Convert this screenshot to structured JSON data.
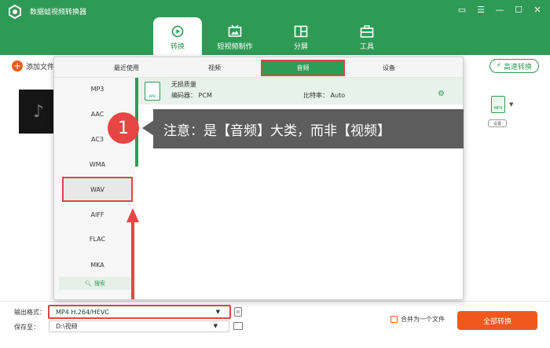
{
  "window": {
    "title": "数据蛙视频转换器",
    "controls": [
      "feedback-icon",
      "menu-icon",
      "minimize-icon",
      "maximize-icon",
      "close-icon"
    ]
  },
  "main_tabs": [
    {
      "label": "转换",
      "icon": "convert-icon",
      "active": true
    },
    {
      "label": "短视频制作",
      "icon": "video-maker-icon",
      "active": false
    },
    {
      "label": "分屏",
      "icon": "split-screen-icon",
      "active": false
    },
    {
      "label": "工具",
      "icon": "toolbox-icon",
      "active": false
    }
  ],
  "toolbar": {
    "add_file_label": "添加文件",
    "fast_convert_label": "高速转换"
  },
  "output_preview": {
    "format_badge": "MP4",
    "settings_label": "设置"
  },
  "format_panel": {
    "tabs": [
      "最近使用",
      "视频",
      "音频",
      "设备"
    ],
    "active_tab": "音频",
    "categories": [
      "MP3",
      "AAC",
      "AC3",
      "WMA",
      "WAV",
      "AIFF",
      "FLAC",
      "MKA"
    ],
    "selected_category": "WAV",
    "search_label": "搜索",
    "format_option": {
      "icon_text": "WAV",
      "name": "无损质量",
      "encoder": "编码器：  PCM",
      "bitrate": "比特率：  Auto"
    }
  },
  "annotation": {
    "step": "1",
    "text": "注意：是【音频】大类，而非【视频】",
    "badge_color": "#e84545",
    "box_color": "#5d5d5d"
  },
  "bottom": {
    "output_format_label": "输出格式：",
    "output_format_value": "MP4 H.264/HEVC",
    "save_to_label": "保存至：",
    "save_to_value": "D:\\视频",
    "merge_label": "合并为一个文件",
    "convert_all_label": "全部转换"
  },
  "colors": {
    "brand_green": "#2f9a56",
    "accent_orange": "#f2581c",
    "highlight_red": "#e04646"
  }
}
